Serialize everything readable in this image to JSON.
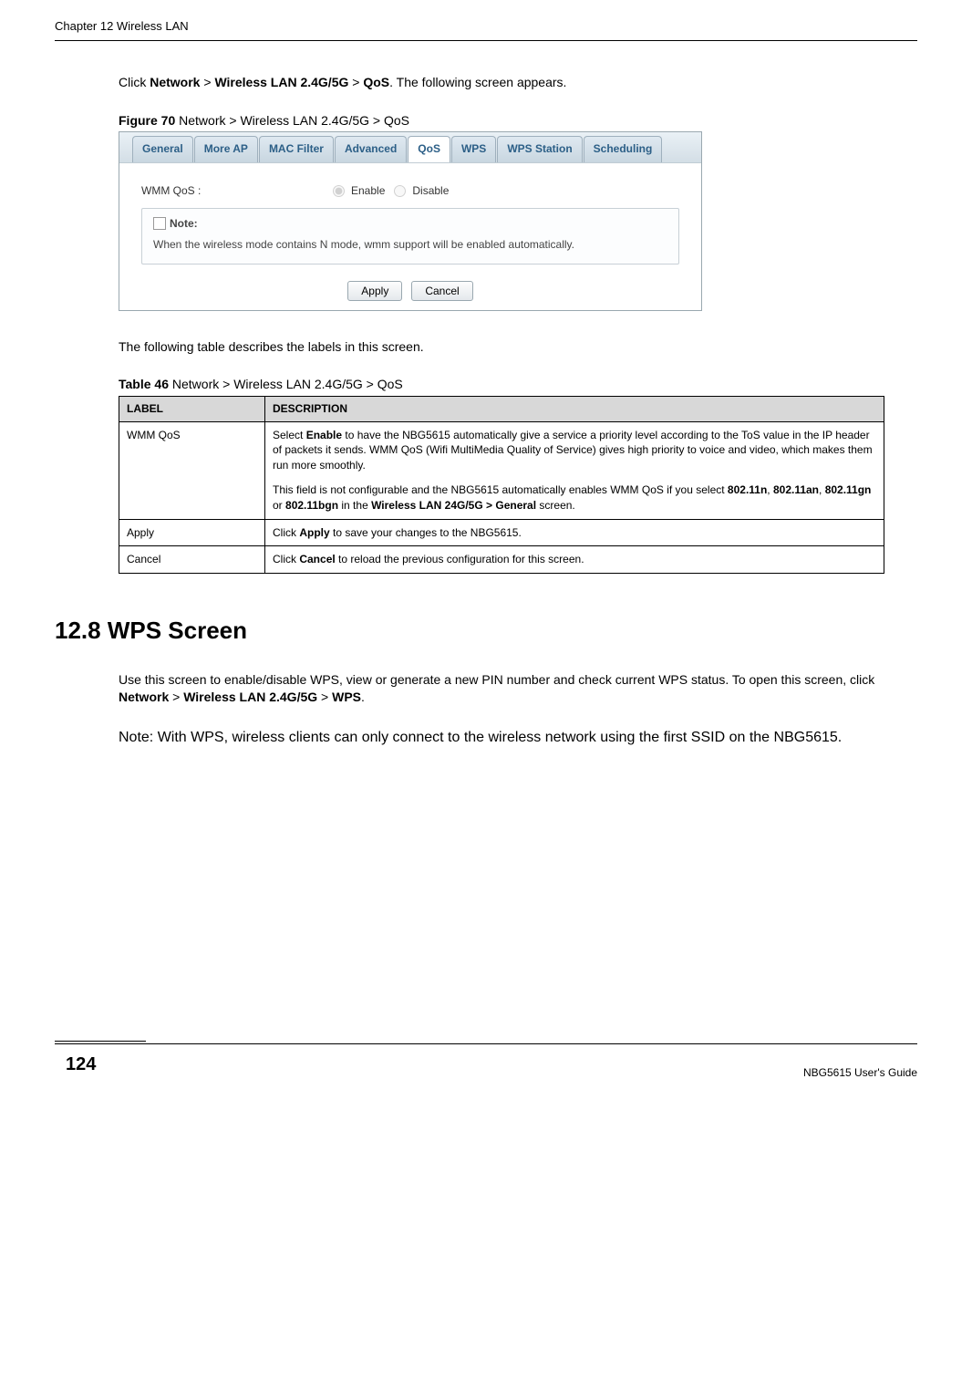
{
  "chapter_header": "Chapter 12 Wireless LAN",
  "intro_prefix": "Click ",
  "intro_strong1": "Network",
  "intro_gt1": " > ",
  "intro_strong2": "Wireless LAN 2.4G/5G",
  "intro_gt2": " > ",
  "intro_strong3": "QoS",
  "intro_suffix": ". The following screen appears.",
  "figure_label_bold": "Figure 70   ",
  "figure_label_rest": "Network > Wireless LAN 2.4G/5G > QoS",
  "tabs": {
    "t0": "General",
    "t1": "More AP",
    "t2": "MAC Filter",
    "t3": "Advanced",
    "t4": "QoS",
    "t5": "WPS",
    "t6": "WPS Station",
    "t7": "Scheduling"
  },
  "form": {
    "wmm_label": "WMM QoS :",
    "enable": "Enable",
    "disable": "Disable"
  },
  "note": {
    "header": "Note:",
    "body": "When the wireless mode contains N mode, wmm support will be enabled automatically."
  },
  "buttons": {
    "apply": "Apply",
    "cancel": "Cancel"
  },
  "para_after_fig": "The following table describes the labels in this screen.",
  "table_caption_bold": "Table 46   ",
  "table_caption_rest": "Network > Wireless LAN 2.4G/5G > QoS",
  "table_headers": {
    "label": "LABEL",
    "desc": "DESCRIPTION"
  },
  "table": {
    "r0": {
      "label": "WMM QoS",
      "d1a": "Select ",
      "d1b": "Enable",
      "d1c": " to have the NBG5615 automatically give a service a priority level according to the ToS value in the IP header of packets it sends. WMM QoS (Wifi MultiMedia Quality of Service) gives high priority to voice and video, which makes them run more smoothly.",
      "d2a": "This field is not configurable and the NBG5615 automatically enables WMM QoS if you select ",
      "d2b": "802.11n",
      "d2c": ", ",
      "d2d": "802.11an",
      "d2e": ", ",
      "d2f": "802.11gn",
      "d2g": " or ",
      "d2h": "802.11bgn",
      "d2i": " in the ",
      "d2j": "Wireless LAN 24G/5G >  General",
      "d2k": " screen."
    },
    "r1": {
      "label": "Apply",
      "da": "Click ",
      "db": "Apply",
      "dc": " to save your changes to the NBG5615."
    },
    "r2": {
      "label": "Cancel",
      "da": "Click ",
      "db": "Cancel",
      "dc": " to reload the previous configuration for this screen."
    }
  },
  "section_title": "12.8  WPS Screen",
  "wps_para_a": "Use this screen to enable/disable WPS, view or generate a new PIN number and check current WPS status. To open this screen, click ",
  "wps_para_b": "Network",
  "wps_para_c": " > ",
  "wps_para_d": "Wireless LAN 2.4G/5G",
  "wps_para_e": " > ",
  "wps_para_f": "WPS",
  "wps_para_g": ".",
  "note_line": "Note: With WPS, wireless clients can only connect to the wireless network using the first SSID on the NBG5615.",
  "page_number": "124",
  "footer_guide": "NBG5615 User's Guide"
}
